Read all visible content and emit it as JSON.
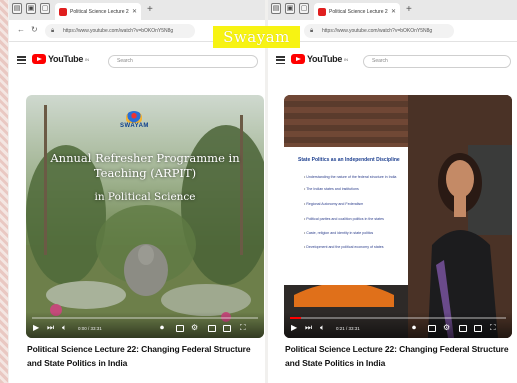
{
  "overlay_label": "Swayam",
  "left": {
    "tab_title": "Political Science Lecture 22: Cha",
    "url": "https://www.youtube.com/watch?v=bOKOnY5N8g",
    "search_placeholder": "Search",
    "youtube_logo": "YouTube",
    "youtube_region": "IN",
    "video": {
      "logo_text": "SWAYAM",
      "slide_title": "Annual Refresher Programme in Teaching (ARPIT)",
      "slide_subtitle": "in Political Science",
      "time": "0:00 / 33:31",
      "progress": 0
    },
    "caption": "Political Science Lecture 22: Changing Federal Structure and State Politics in India"
  },
  "right": {
    "tab_title": "Political Science Lecture 22: Cha",
    "url": "https://www.youtube.com/watch?v=bOKOnY5N8g",
    "search_placeholder": "Search",
    "youtube_logo": "YouTube",
    "youtube_region": "IN",
    "video": {
      "slide_heading": "State Politics as an Independent Discipline",
      "slide_bullets": [
        "Understanding the nature of the federal structure in India",
        "The Indian states and institutions",
        "Regional Autonomy and Federalism",
        "Political parties and coalition politics in the states",
        "Caste, religion and identity in state politics",
        "Development and the political economy of states"
      ],
      "time": "0:21 / 33:31",
      "progress": 0.05
    },
    "caption": "Political Science Lecture 22: Changing Federal Structure and State Politics in India"
  },
  "colors": {
    "youtube_red": "#ff0000",
    "overlay_yellow": "#f7f313",
    "slide_title_blue": "#1d3f8f"
  }
}
